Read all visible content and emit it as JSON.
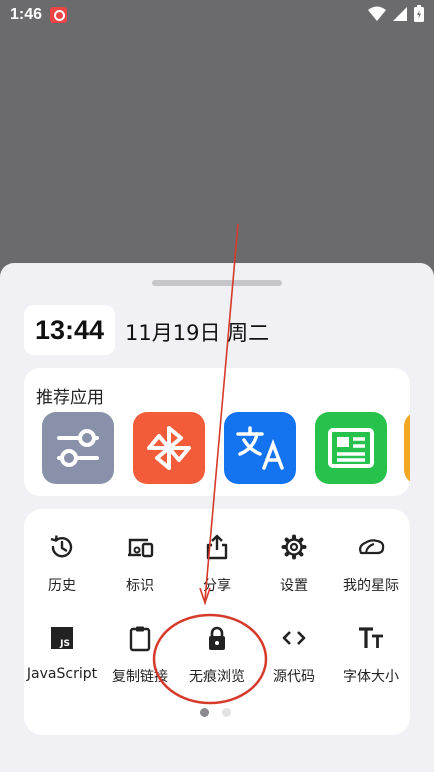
{
  "status_bar": {
    "time": "1:46"
  },
  "widget": {
    "clock": "13:44",
    "date": "11月19日 周二"
  },
  "recommended": {
    "title": "推荐应用",
    "apps": [
      {
        "icon": "sliders-icon",
        "color": "#8890aa"
      },
      {
        "icon": "pinwheel-icon",
        "color": "#f25c3a"
      },
      {
        "icon": "translate-icon",
        "color": "#1473f0"
      },
      {
        "icon": "news-icon",
        "color": "#27c24c"
      },
      {
        "icon": "app-icon",
        "color": "#f5a623"
      }
    ]
  },
  "menu": {
    "items": [
      {
        "label": "历史",
        "icon": "history-icon"
      },
      {
        "label": "标识",
        "icon": "devices-icon"
      },
      {
        "label": "分享",
        "icon": "share-icon"
      },
      {
        "label": "设置",
        "icon": "gear-icon"
      },
      {
        "label": "我的星际",
        "icon": "cloud-icon"
      },
      {
        "label": "JavaScript",
        "icon": "javascript-icon"
      },
      {
        "label": "复制链接",
        "icon": "clipboard-icon"
      },
      {
        "label": "无痕浏览",
        "icon": "lock-icon"
      },
      {
        "label": "源代码",
        "icon": "code-icon"
      },
      {
        "label": "字体大小",
        "icon": "font-size-icon"
      }
    ],
    "page": 1,
    "pages": 2
  },
  "colors": {
    "sheet": "#f1f0f5",
    "annotation": "#d63a2a",
    "dim_backdrop": "#6b6b6d"
  }
}
